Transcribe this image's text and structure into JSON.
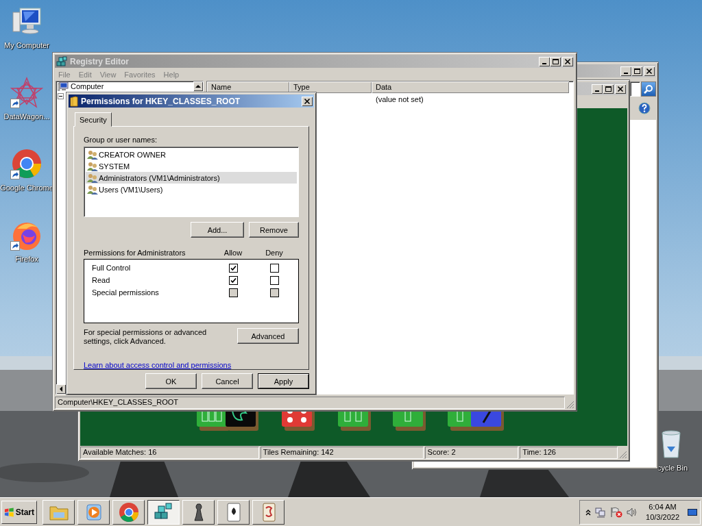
{
  "desktop_icons": [
    {
      "label": "My Computer",
      "kind": "computer",
      "shortcut": false
    },
    {
      "label": "DataWagon...",
      "kind": "datawagon",
      "shortcut": true
    },
    {
      "label": "Google Chrome",
      "kind": "chrome",
      "shortcut": true
    },
    {
      "label": "Firefox",
      "kind": "firefox",
      "shortcut": true
    }
  ],
  "recycle_bin": {
    "label": "cycle Bin"
  },
  "mahjong_window": {
    "status_bar": [
      "Available Matches: 16",
      "Tiles Remaining: 142",
      "Score: 2",
      "Time: 126"
    ]
  },
  "registry_editor": {
    "title": "Registry Editor",
    "active": false,
    "menu": [
      "File",
      "Edit",
      "View",
      "Favorites",
      "Help"
    ],
    "tree": [
      {
        "label": "Computer"
      }
    ],
    "columns": [
      "Name",
      "Type",
      "Data"
    ],
    "rows": [
      {
        "data": "(value not set)"
      }
    ],
    "status_bar": "Computer\\HKEY_CLASSES_ROOT"
  },
  "permissions_dialog": {
    "title": "Permissions for HKEY_CLASSES_ROOT",
    "active": true,
    "tabs": [
      {
        "label": "Security",
        "selected": true
      }
    ],
    "group_label": "Group or user names:",
    "principals": [
      {
        "name": "CREATOR OWNER",
        "selected": false
      },
      {
        "name": "SYSTEM",
        "selected": false
      },
      {
        "name": "Administrators (VM1\\Administrators)",
        "selected": true
      },
      {
        "name": "Users (VM1\\Users)",
        "selected": false
      }
    ],
    "principal_buttons": [
      "Add...",
      "Remove"
    ],
    "permissions_label": "Permissions for Administrators",
    "allow_header": "Allow",
    "deny_header": "Deny",
    "permissions": [
      {
        "name": "Full Control",
        "allow": true,
        "deny": false,
        "disabled": false
      },
      {
        "name": "Read",
        "allow": true,
        "deny": false,
        "disabled": false
      },
      {
        "name": "Special permissions",
        "allow": false,
        "deny": false,
        "disabled": true
      }
    ],
    "advanced_note": "For special permissions or advanced settings, click Advanced.",
    "advanced_button": "Advanced",
    "help_link": "Learn about access control and permissions",
    "buttons": [
      "OK",
      "Cancel",
      "Apply"
    ]
  },
  "taskbar": {
    "start": "Start",
    "tasks": [
      {
        "kind": "explorer",
        "active": false
      },
      {
        "kind": "media",
        "active": false
      },
      {
        "kind": "chrome",
        "active": false
      },
      {
        "kind": "regedit",
        "active": true
      },
      {
        "kind": "chess",
        "active": false
      },
      {
        "kind": "solitaire",
        "active": false
      },
      {
        "kind": "mahjong",
        "active": false
      }
    ],
    "time": "6:04 AM",
    "date": "10/3/2022"
  }
}
